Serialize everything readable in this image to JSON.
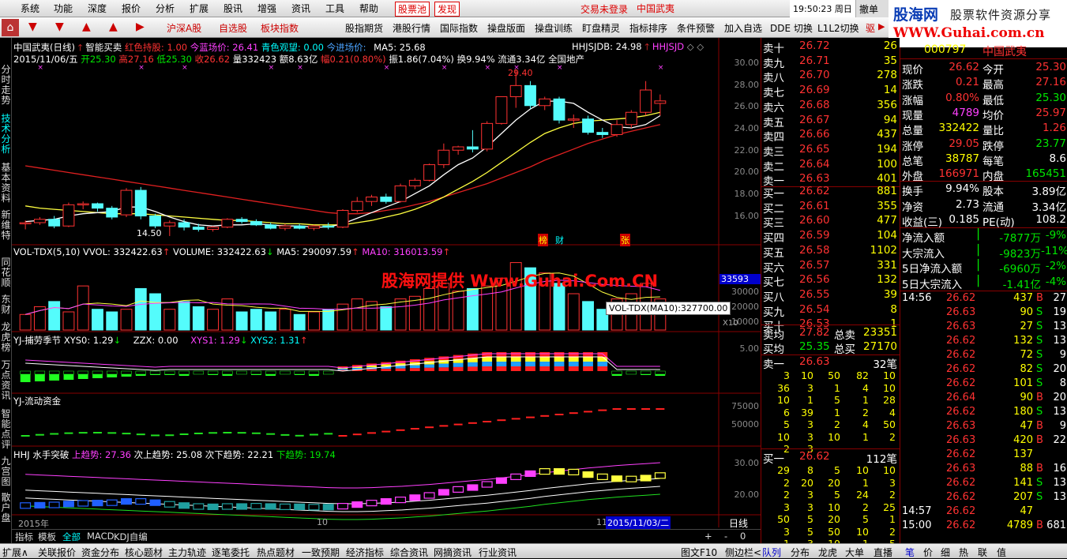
{
  "menu": {
    "items": [
      "系统",
      "功能",
      "深度",
      "报价",
      "分析",
      "扩展",
      "股讯",
      "增强",
      "资讯",
      "工具",
      "帮助"
    ],
    "tabs": [
      "股票池",
      "发现"
    ],
    "status": "交易未登录",
    "stock": "中国武夷",
    "clock": "19:50:23 周日",
    "right": [
      "撤单",
      "买入"
    ]
  },
  "logo": {
    "line1a": "股海网",
    "line1b": "股票软件资源分享",
    "line2": "WWW.Guhai.com.cn"
  },
  "toolbar": {
    "items": [
      "沪深A股",
      "自选股",
      "板块指数",
      "股指期货",
      "港股行情",
      "国际指数",
      "操盘版面",
      "操盘训练",
      "盯盘精灵",
      "指标排序",
      "条件预警",
      "加入自选",
      "DDE 切换",
      "L1L2切换",
      "驱"
    ]
  },
  "lefttabs": [
    "分时走势",
    "技术分析",
    "基本资料",
    "新维特",
    "同花顺",
    "东财",
    "龙虎榜",
    "万点资讯",
    "智能点评",
    "九宫图",
    "散户盘"
  ],
  "chart": {
    "header1": {
      "name": "中国武夷(日线)",
      "tag1": "智能买卖",
      "tag2": "红色持股: 1.00",
      "tag3": "今蓝场价: 26.41",
      "tag4": "青色观望: 0.00",
      "tag5": "今进场价:",
      "ma": "MA5: 25.68",
      "hhjs": "HHJSJDB: 24.98",
      "hhjsd": "HHJSJD"
    },
    "header2": {
      "date": "2015/11/06/五",
      "open": "开25.30",
      "high": "高27.16",
      "low": "低25.30",
      "close": "收26.62",
      "vol": "量332423",
      "amt": "额8.63亿",
      "chg": "幅0.21(0.80%)",
      "amp": "振1.86(7.04%)",
      "turn": "换9.94%",
      "float": "流通3.34亿",
      "sector": "全国地产"
    },
    "peak_label": "29.40",
    "low_label": "14.50",
    "tags": [
      "榜",
      "财",
      "张"
    ],
    "vol_header": {
      "a": "VOL-TDX(5,10)",
      "b": "VVOL: 332422.63",
      "c": "VOLUME: 332422.63",
      "d": "MA5: 290097.59",
      "e": "MA10: 316013.59"
    },
    "vol_tip": "VOL-TDX(MA10):327700.00",
    "vol_box": "33593",
    "vol_x": "X10",
    "ind1": {
      "a": "YJ-捕劳季节",
      "b": "XYS0: 1.29",
      "c": "ZZX: 0.00",
      "d": "XYS1: 1.29",
      "e": "XYS2: 1.31"
    },
    "ind2": "YJ-流动资金",
    "ind3": {
      "a": "HHJ 水手突破",
      "b": "上趋势: 27.36",
      "c": "次上趋势: 25.08",
      "d": "次下趋势: 22.21",
      "e": "下趋势: 19.74"
    },
    "watermark": "股海网提供 Www.Guhai.Com.CN",
    "xaxis": {
      "a": "2015年",
      "b": "10",
      "c": "11",
      "d": "2015/11/03/二",
      "e": "日线"
    },
    "yaxis_price": [
      "30.00",
      "28.00",
      "26.00",
      "24.00",
      "22.00",
      "20.00",
      "18.00",
      "16.00"
    ],
    "yaxis_vol": [
      "30000",
      "20000",
      "10000"
    ],
    "yaxis_ind1": "5.00",
    "yaxis_ind2": [
      "75000",
      "50000"
    ],
    "yaxis_ind3": [
      "30.00",
      "20.00"
    ],
    "candles": [
      [
        1,
        15.6,
        15.9,
        15.1,
        15.7
      ],
      [
        2,
        15.7,
        16.2,
        15.5,
        16.0
      ],
      [
        3,
        16.0,
        16.3,
        15.2,
        15.4
      ],
      [
        4,
        15.4,
        17.5,
        15.3,
        17.3
      ],
      [
        5,
        17.3,
        17.6,
        16.9,
        17.4
      ],
      [
        6,
        17.4,
        17.5,
        16.7,
        17.0
      ],
      [
        7,
        17.0,
        17.2,
        16.0,
        16.2
      ],
      [
        8,
        16.4,
        18.8,
        16.2,
        18.6
      ],
      [
        9,
        18.6,
        18.9,
        16.0,
        16.3
      ],
      [
        10,
        16.3,
        16.5,
        15.2,
        15.4
      ],
      [
        11,
        15.4,
        15.9,
        14.5,
        15.7
      ],
      [
        12,
        15.7,
        16.0,
        15.0,
        15.3
      ],
      [
        13,
        15.3,
        15.6,
        14.9,
        15.1
      ],
      [
        14,
        15.1,
        15.4,
        14.9,
        15.3
      ],
      [
        15,
        15.3,
        16.1,
        15.2,
        16.0
      ],
      [
        16,
        16.0,
        16.2,
        15.6,
        15.8
      ],
      [
        17,
        15.8,
        16.0,
        15.4,
        15.5
      ],
      [
        18,
        15.5,
        15.7,
        15.1,
        15.2
      ],
      [
        19,
        15.2,
        15.6,
        15.0,
        15.4
      ],
      [
        20,
        15.4,
        15.6,
        15.1,
        15.2
      ],
      [
        21,
        15.2,
        15.5,
        15.0,
        15.4
      ],
      [
        22,
        15.4,
        15.7,
        15.1,
        15.3
      ],
      [
        23,
        15.3,
        16.9,
        15.2,
        16.8
      ],
      [
        24,
        16.8,
        18.0,
        16.6,
        17.6
      ],
      [
        25,
        17.6,
        18.2,
        17.2,
        18.0
      ],
      [
        26,
        18.0,
        18.3,
        17.4,
        17.6
      ],
      [
        27,
        17.6,
        19.2,
        17.5,
        19.0
      ],
      [
        28,
        19.0,
        19.7,
        18.7,
        19.5
      ],
      [
        29,
        19.5,
        21.0,
        19.4,
        20.9
      ],
      [
        30,
        20.9,
        22.8,
        20.6,
        22.2
      ],
      [
        31,
        22.2,
        22.6,
        21.8,
        22.5
      ],
      [
        32,
        22.5,
        24.0,
        22.0,
        22.3
      ],
      [
        33,
        22.3,
        24.8,
        22.1,
        24.6
      ],
      [
        34,
        24.6,
        27.0,
        24.5,
        27.0
      ],
      [
        35,
        27.0,
        29.4,
        26.0,
        28.0
      ],
      [
        36,
        28.0,
        28.4,
        25.9,
        26.2
      ],
      [
        37,
        26.2,
        27.0,
        25.8,
        26.8
      ],
      [
        38,
        26.8,
        27.0,
        24.6,
        24.9
      ],
      [
        39,
        24.9,
        25.4,
        24.2,
        25.0
      ],
      [
        40,
        25.0,
        25.3,
        23.6,
        23.8
      ],
      [
        41,
        23.8,
        24.2,
        23.3,
        23.6
      ],
      [
        42,
        23.6,
        24.9,
        23.4,
        24.5
      ],
      [
        43,
        24.5,
        25.8,
        24.2,
        25.6
      ],
      [
        44,
        25.6,
        28.4,
        25.3,
        27.6
      ],
      [
        45,
        26.4,
        27.2,
        25.3,
        26.62
      ]
    ],
    "ma5": [
      15.8,
      15.9,
      16.0,
      16.3,
      16.5,
      16.6,
      16.7,
      17.1,
      17.1,
      16.7,
      16.2,
      15.8,
      15.5,
      15.4,
      15.5,
      15.5,
      15.6,
      15.5,
      15.4,
      15.4,
      15.3,
      15.3,
      15.6,
      16.1,
      16.6,
      17.1,
      17.6,
      18.3,
      19.0,
      20.0,
      20.9,
      21.5,
      22.5,
      23.7,
      24.9,
      25.9,
      26.6,
      26.6,
      26.4,
      25.6,
      24.9,
      24.3,
      24.2,
      24.5,
      25.3
    ],
    "ma10": [
      17.2,
      17.0,
      16.9,
      16.8,
      16.7,
      16.6,
      16.5,
      16.5,
      16.5,
      16.4,
      16.3,
      16.2,
      16.1,
      16.0,
      15.9,
      15.9,
      15.8,
      15.7,
      15.6,
      15.6,
      15.5,
      15.5,
      15.5,
      15.7,
      15.9,
      16.2,
      16.5,
      16.9,
      17.4,
      18.0,
      18.7,
      19.4,
      20.2,
      21.1,
      22.0,
      22.9,
      23.7,
      24.2,
      24.6,
      24.8,
      24.9,
      25.0,
      25.1,
      25.3,
      25.6
    ],
    "ma60": [
      20.8,
      20.6,
      20.4,
      20.2,
      20.0,
      19.8,
      19.6,
      19.4,
      19.2,
      19.0,
      18.8,
      18.6,
      18.4,
      18.2,
      18.0,
      17.8,
      17.6,
      17.4,
      17.2,
      17.0,
      16.8,
      16.6,
      16.5,
      16.5,
      16.6,
      16.8,
      17.0,
      17.3,
      17.6,
      18.0,
      18.4,
      18.8,
      19.2,
      19.7,
      20.2,
      20.7,
      21.3,
      21.8,
      22.3,
      22.8,
      23.2,
      23.6,
      23.9,
      24.2,
      24.5
    ],
    "vols": [
      6,
      9,
      11,
      7,
      17,
      8,
      7,
      8,
      16,
      14,
      8,
      11,
      9,
      8,
      12,
      7,
      8,
      7,
      8,
      6,
      7,
      8,
      10,
      12,
      11,
      9,
      12,
      13,
      16,
      18,
      15,
      16,
      17,
      20,
      26,
      24,
      22,
      18,
      14,
      11,
      8,
      12,
      14,
      18,
      12
    ]
  },
  "quote": {
    "sell": [
      [
        "卖十",
        "26.72",
        "26"
      ],
      [
        "卖九",
        "26.71",
        "35"
      ],
      [
        "卖八",
        "26.70",
        "278"
      ],
      [
        "卖七",
        "26.69",
        "14"
      ],
      [
        "卖六",
        "26.68",
        "356"
      ],
      [
        "卖五",
        "26.67",
        "94"
      ],
      [
        "卖四",
        "26.66",
        "437"
      ],
      [
        "卖三",
        "26.65",
        "194"
      ],
      [
        "卖二",
        "26.64",
        "100"
      ],
      [
        "卖一",
        "26.63",
        "401"
      ]
    ],
    "buy": [
      [
        "买一",
        "26.62",
        "881"
      ],
      [
        "买二",
        "26.61",
        "355"
      ],
      [
        "买三",
        "26.60",
        "477"
      ],
      [
        "买四",
        "26.59",
        "104"
      ],
      [
        "买五",
        "26.58",
        "1102"
      ],
      [
        "买六",
        "26.57",
        "331"
      ],
      [
        "买七",
        "26.56",
        "132"
      ],
      [
        "买八",
        "26.55",
        "39"
      ],
      [
        "买九",
        "26.54",
        "8"
      ],
      [
        "买十",
        "26.53",
        "1"
      ]
    ],
    "sellavg": {
      "label": "卖均",
      "price": "27.82",
      "tlabel": "总卖",
      "total": "23351"
    },
    "buyavg": {
      "label": "买均",
      "price": "25.35",
      "tlabel": "总买",
      "total": "27170"
    },
    "sell1": {
      "label": "卖一",
      "price": "26.63",
      "count": "32笔"
    },
    "sellq": [
      [
        "3",
        "10",
        "50",
        "82",
        "10"
      ],
      [
        "36",
        "3",
        "1",
        "4",
        "10"
      ],
      [
        "10",
        "1",
        "5",
        "1",
        "28"
      ],
      [
        "6",
        "39",
        "1",
        "2",
        "4"
      ],
      [
        "5",
        "3",
        "2",
        "4",
        "50"
      ],
      [
        "10",
        "3",
        "10",
        "1",
        "2"
      ],
      [
        "2",
        "3",
        "",
        "",
        ""
      ]
    ],
    "buy1": {
      "label": "买一",
      "price": "26.62",
      "count": "112笔"
    },
    "buyq": [
      [
        "29",
        "8",
        "5",
        "10",
        "10"
      ],
      [
        "2",
        "20",
        "20",
        "1",
        "3"
      ],
      [
        "2",
        "3",
        "5",
        "24",
        "2"
      ],
      [
        "3",
        "3",
        "10",
        "2",
        "25"
      ],
      [
        "50",
        "5",
        "20",
        "5",
        "1"
      ],
      [
        "3",
        "5",
        "50",
        "10",
        "2"
      ],
      [
        "1",
        "3",
        "10",
        "1",
        "5"
      ]
    ]
  },
  "detail": {
    "code": "000797",
    "name": "中国武夷",
    "rows": [
      [
        "现价",
        "26.62",
        "今开",
        "25.30"
      ],
      [
        "涨跌",
        "0.21",
        "最高",
        "27.16"
      ],
      [
        "涨幅",
        "0.80%",
        "最低",
        "25.30"
      ],
      [
        "现量",
        "4789",
        "均价",
        "25.97"
      ],
      [
        "总量",
        "332422",
        "量比",
        "1.26"
      ],
      [
        "涨停",
        "29.05",
        "跌停",
        "23.77"
      ],
      [
        "总笔",
        "38787",
        "每笔",
        "8.6"
      ],
      [
        "外盘",
        "166971",
        "内盘",
        "165451"
      ],
      [
        "换手",
        "9.94%",
        "股本",
        "3.89亿"
      ],
      [
        "净资",
        "2.73",
        "流通",
        "3.34亿"
      ],
      [
        "收益(三)",
        "0.185",
        "PE(动)",
        "108.2"
      ]
    ],
    "flows": [
      [
        "净流入额",
        "-7877万",
        "-9%"
      ],
      [
        "大宗流入",
        "-9823万",
        "-11%"
      ],
      [
        "5日净流入额",
        "-6960万",
        "-2%"
      ],
      [
        "5日大宗流入",
        "-1.41亿",
        "-4%"
      ]
    ],
    "ticks": [
      [
        "14:56",
        "26.62",
        "437",
        "B",
        "27"
      ],
      [
        "",
        "26.63",
        "90",
        "S",
        "19"
      ],
      [
        "",
        "26.63",
        "27",
        "S",
        "13"
      ],
      [
        "",
        "26.62",
        "132",
        "S",
        "13"
      ],
      [
        "",
        "26.62",
        "72",
        "S",
        "9"
      ],
      [
        "",
        "26.62",
        "82",
        "S",
        "20"
      ],
      [
        "",
        "26.62",
        "101",
        "S",
        "8"
      ],
      [
        "",
        "26.64",
        "90",
        "B",
        "20"
      ],
      [
        "",
        "26.62",
        "180",
        "S",
        "13"
      ],
      [
        "",
        "26.63",
        "47",
        "B",
        "9"
      ],
      [
        "",
        "26.63",
        "420",
        "B",
        "22"
      ],
      [
        "",
        "26.62",
        "137",
        "",
        ""
      ],
      [
        "",
        "26.63",
        "88",
        "B",
        "16"
      ],
      [
        "",
        "26.62",
        "141",
        "S",
        "13"
      ],
      [
        "",
        "26.62",
        "207",
        "S",
        "13"
      ],
      [
        "14:57",
        "26.62",
        "47",
        "",
        ""
      ],
      [
        "15:00",
        "26.62",
        "4789",
        "B",
        "681"
      ]
    ]
  },
  "subtabs": [
    "指标",
    "模板",
    "全部",
    "MACD",
    "KDJ自编"
  ],
  "bottom": [
    "扩展∧",
    "关联报价",
    "资金分布",
    "核心题材",
    "主力轨迹",
    "逐笔委托",
    "热点题材",
    "一致预期",
    "经济指标",
    "综合资讯",
    "网摘资讯",
    "行业资讯",
    "图文F10",
    "侧边栏<",
    "队列",
    "分布",
    "龙虎",
    "大单",
    "直播",
    "笔",
    "价",
    "细",
    "热",
    "联",
    "值"
  ]
}
